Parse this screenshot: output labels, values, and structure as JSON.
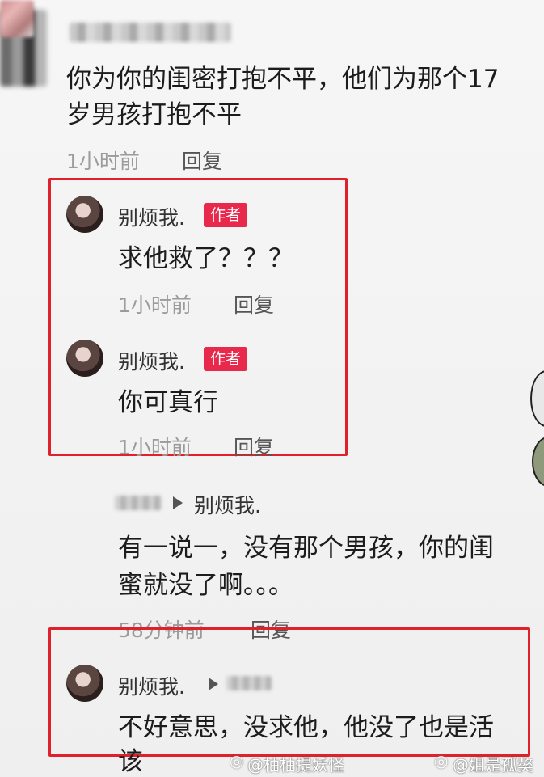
{
  "comments": [
    {
      "text_line1": "你为你的闺密打抱不平，他们为那个17",
      "text_line2": "岁男孩打抱不平",
      "time": "1小时前",
      "reply": "回复"
    },
    {
      "username": "别烦我.",
      "badge": "作者",
      "text": "求他救了？？？",
      "time": "1小时前",
      "reply": "回复"
    },
    {
      "username": "别烦我.",
      "badge": "作者",
      "text": "你可真行",
      "time": "1小时前",
      "reply": "回复"
    },
    {
      "reply_to": "别烦我.",
      "text_line1": "有一说一，没有那个男孩，你的闺",
      "text_line2": "蜜就没了啊。。。",
      "time": "58分钟前",
      "reply": "回复"
    },
    {
      "username": "别烦我.",
      "text_line1": "不好意思，没求他，他没了也是活",
      "text_line2": "该"
    }
  ],
  "watermarks": {
    "left": "@柚柚提妖怪",
    "right": "@姐是孤獒"
  },
  "colors": {
    "highlight_box": "#e0202a",
    "author_badge": "#e8294b"
  }
}
